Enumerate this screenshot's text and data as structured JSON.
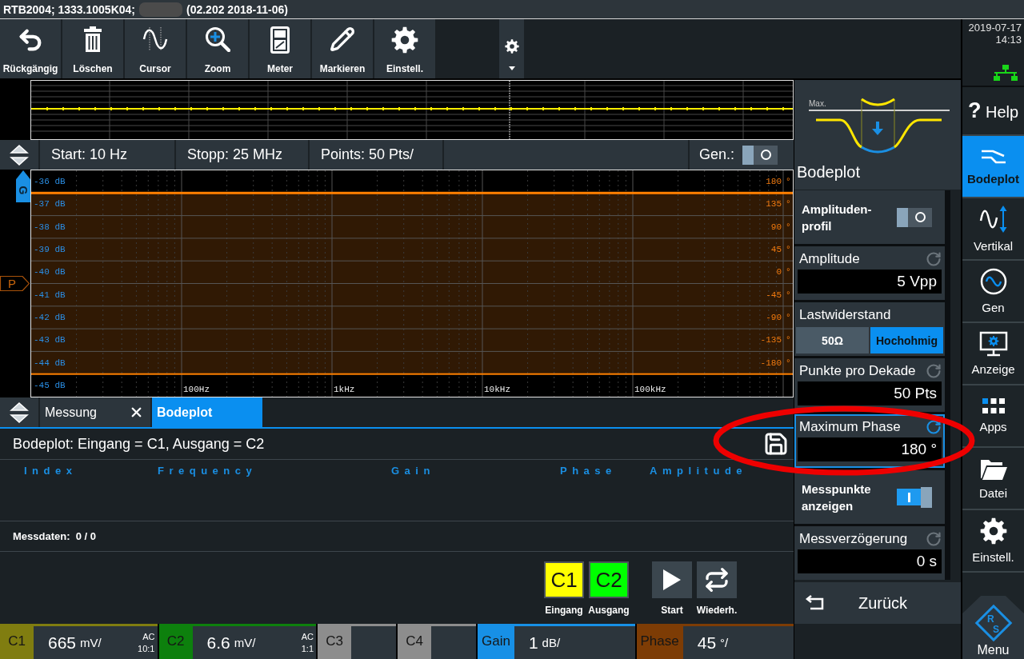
{
  "title_bar": {
    "device": "RTB2004; 1333.1005K04;",
    "version": "(02.202 2018-11-06)"
  },
  "toolbar": [
    {
      "label": "Rückgängig",
      "kind": "undo"
    },
    {
      "label": "Löschen",
      "kind": "delete"
    },
    {
      "label": "Cursor",
      "kind": "cursor"
    },
    {
      "label": "Zoom",
      "kind": "zoom"
    },
    {
      "label": "Meter",
      "kind": "meter"
    },
    {
      "label": "Markieren",
      "kind": "mark"
    },
    {
      "label": "Einstell.",
      "kind": "settings"
    }
  ],
  "clock": {
    "date": "2019-07-17",
    "time": "14:13"
  },
  "sweep_bar": {
    "fields": [
      "Start: 10 Hz",
      "Stopp: 25 MHz",
      "Points: 50 Pts/"
    ],
    "generator": {
      "label": "Gen.:",
      "on": false
    }
  },
  "plot": {
    "markers": [
      {
        "letter": "G",
        "kind": "gain"
      },
      {
        "letter": "P",
        "kind": "phase"
      }
    ],
    "gain_labels": [
      "-36 dB",
      "-37 dB",
      "-38 dB",
      "-39 dB",
      "-40 dB",
      "-41 dB",
      "-42 dB",
      "-43 dB",
      "-44 dB",
      "-45 dB"
    ],
    "phase_labels": [
      {
        "value": "180",
        "unit": "°"
      },
      {
        "value": "135",
        "unit": "°"
      },
      {
        "value": "90",
        "unit": "°"
      },
      {
        "value": "45",
        "unit": "°"
      },
      {
        "value": "0",
        "unit": "°"
      },
      {
        "value": "-45",
        "unit": "°"
      },
      {
        "value": "-90",
        "unit": "°"
      },
      {
        "value": "-135",
        "unit": "°"
      },
      {
        "value": "-180",
        "unit": "°"
      }
    ],
    "frequency_labels": [
      "100Hz",
      "1kHz",
      "10kHz",
      "100kHz"
    ]
  },
  "result_tabs": [
    {
      "label": "Messung",
      "selected": false,
      "closable": true
    },
    {
      "label": "Bodeplot",
      "selected": true,
      "closable": false
    }
  ],
  "result": {
    "title": "Bodeplot: Eingang = C1, Ausgang = C2",
    "columns": [
      "Index",
      "Frequency",
      "Gain",
      "Phase",
      "Amplitude"
    ],
    "footer": "Messdaten:  0 / 0"
  },
  "sources": [
    {
      "label": "C1",
      "caption": "Eingang",
      "color": "#ffff00"
    },
    {
      "label": "C2",
      "caption": "Ausgang",
      "color": "#00ff00"
    }
  ],
  "actions": [
    {
      "caption": "Start",
      "kind": "play"
    },
    {
      "caption": "Wiederh.",
      "kind": "repeat"
    }
  ],
  "status_bar": [
    {
      "label": "C1",
      "value": "665",
      "unit": "mV/",
      "coupling": "AC",
      "probe": "10:1",
      "color": "#807d10"
    },
    {
      "label": "C2",
      "value": "6.6",
      "unit": "mV/",
      "coupling": "AC",
      "probe": "1:1",
      "color": "#0d800d"
    },
    {
      "label": "C3",
      "color": "#8d8d8d"
    },
    {
      "label": "C4",
      "color": "#8d8d8d"
    },
    {
      "label": "Gain",
      "value": "1",
      "unit": "dB/",
      "color": "#1790e6"
    },
    {
      "label": "Phase",
      "value": "45",
      "unit": "°/",
      "color": "#7d3c05"
    }
  ],
  "panel": {
    "illustration_label": "Max.",
    "title": "Bodeplot",
    "items": [
      {
        "kind": "toggle",
        "label": "Amplituden-profil",
        "on": false
      },
      {
        "kind": "value",
        "label": "Amplitude",
        "field": {
          "value": "5 Vpp"
        },
        "focused": false
      },
      {
        "kind": "choice",
        "label": "Lastwiderstand",
        "options": [
          {
            "label": "50Ω",
            "selected": false
          },
          {
            "label": "Hochohmig",
            "selected": true
          }
        ]
      },
      {
        "kind": "value",
        "label": "Punkte pro Dekade",
        "field": {
          "value": "50 Pts"
        },
        "focused": false
      },
      {
        "kind": "value",
        "label": "Maximum Phase",
        "field": {
          "value": "180 °"
        },
        "focused": true
      },
      {
        "kind": "toggle",
        "label": "Messpunkte anzeigen",
        "on": true
      },
      {
        "kind": "value",
        "label": "Messverzögerung",
        "field": {
          "value": "0 s"
        },
        "focused": false
      }
    ],
    "back": "Zurück"
  },
  "sidebar": {
    "help": {
      "mark": "?",
      "label": "Help"
    },
    "items": [
      {
        "label": "Bodeplot",
        "kind": "bode",
        "selected": true
      },
      {
        "label": "Vertikal",
        "kind": "vertical",
        "selected": false
      },
      {
        "label": "Gen",
        "kind": "generator",
        "selected": false
      },
      {
        "label": "Anzeige",
        "kind": "display",
        "selected": false
      },
      {
        "label": "Apps",
        "kind": "apps",
        "selected": false
      },
      {
        "label": "Datei",
        "kind": "file",
        "selected": false
      },
      {
        "label": "Einstell.",
        "kind": "settings",
        "selected": false
      }
    ],
    "menu": {
      "label": "Menu",
      "logo_letters": [
        "R",
        "S"
      ]
    }
  },
  "annotation": {
    "kind": "ellipse"
  }
}
